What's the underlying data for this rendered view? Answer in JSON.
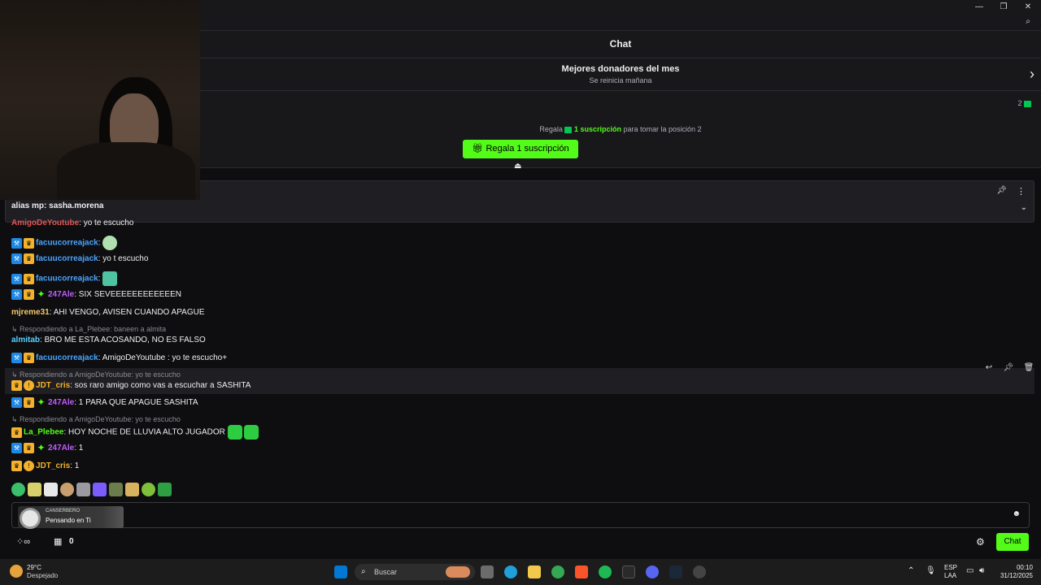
{
  "window": {
    "minimize_icon": "minimize-icon",
    "maximize_icon": "restore-icon",
    "close_icon": "close-icon",
    "zoom_icon": "zoom-icon"
  },
  "chat": {
    "title": "Chat"
  },
  "donors": {
    "title": "Mejores donadores del mes",
    "subtitle": "Se reinicia mañana",
    "rank_count": "2"
  },
  "gift": {
    "prefix": "Regala",
    "highlight": "1 suscripción",
    "suffix": "para tomar la posición 2",
    "button_label": "Regala 1 suscripción"
  },
  "pinned": {
    "text": "alias mp: sasha.morena"
  },
  "messages": [
    {
      "user": "AmigoDeYoutube",
      "text": ": yo te escucho",
      "color": "#e05555"
    },
    {
      "user": "facuucorreajack",
      "text": ":",
      "color": "#4aa3ff"
    },
    {
      "user": "facuucorreajack",
      "text": ": yo t escucho",
      "color": "#4aa3ff"
    },
    {
      "user": "facuucorreajack",
      "text": ":",
      "color": "#4aa3ff"
    },
    {
      "user": "247Ale",
      "text": ": SIX SEVEEEEEEEEEEEEN",
      "color": "#c15cff"
    },
    {
      "user": "mjreme31",
      "text": ": AHI VENGO, AVISEN CUANDO APAGUE",
      "color": "#f7c76a"
    },
    {
      "user": "almitab",
      "text": ": BRO ME ESTA ACOSANDO, NO ES FALSO",
      "color": "#5bd0ff"
    },
    {
      "user": "facuucorreajack",
      "text": ": AmigoDeYoutube : yo te escucho+",
      "color": "#4aa3ff"
    },
    {
      "user": "JDT_cris",
      "text": ": sos raro amigo como vas a escuchar a SASHITA",
      "color": "#f3b12c"
    },
    {
      "user": "247Ale",
      "text": ": 1 PARA QUE APAGUE SASHITA",
      "color": "#c15cff"
    },
    {
      "user": "La_Plebee",
      "text": ": HOY NOCHE DE LLUVIA ALTO JUGADOR",
      "color": "#53fc18"
    },
    {
      "user": "247Ale",
      "text": ": 1",
      "color": "#c15cff"
    },
    {
      "user": "JDT_cris",
      "text": ": 1",
      "color": "#f3b12c"
    }
  ],
  "replies": [
    {
      "text": "Respondiendo a La_Plebee: baneen a almita"
    },
    {
      "text": "Respondiendo a AmigoDeYoutube: yo te escucho"
    },
    {
      "text": "Respondiendo a AmigoDeYoutube: yo te escucho"
    }
  ],
  "now_playing": {
    "artist": "CANSERBERO",
    "song": "Pensando en Ti"
  },
  "bottom": {
    "follow_count": "0",
    "chat_button": "Chat"
  },
  "taskbar": {
    "temp": "29°C",
    "weather": "Despejado",
    "search": "Buscar",
    "lang1": "ESP",
    "lang2": "LAA",
    "time": "00:10",
    "date": "31/12/2025"
  },
  "colors": {
    "accent": "#53fc18",
    "bg": "#0e0e10"
  }
}
